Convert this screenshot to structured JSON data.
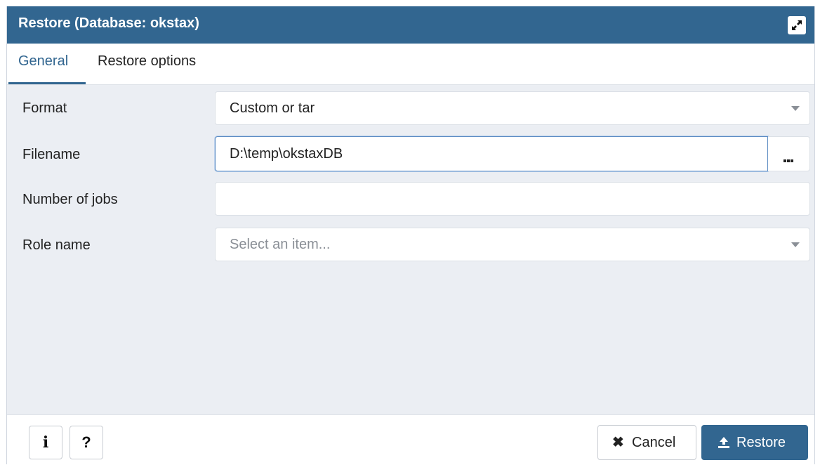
{
  "dialog": {
    "title": "Restore (Database: okstax)",
    "maximize_icon": "expand-icon"
  },
  "tabs": [
    {
      "label": "General",
      "active": true
    },
    {
      "label": "Restore options",
      "active": false
    }
  ],
  "form": {
    "format": {
      "label": "Format",
      "value": "Custom or tar"
    },
    "filename": {
      "label": "Filename",
      "value": "D:\\temp\\okstaxDB",
      "browse_icon": "ellipsis-icon"
    },
    "jobs": {
      "label": "Number of jobs",
      "value": ""
    },
    "role": {
      "label": "Role name",
      "placeholder": "Select an item..."
    }
  },
  "footer": {
    "info_glyph": "i",
    "help_glyph": "?",
    "cancel_icon": "✖",
    "cancel_label": "Cancel",
    "restore_icon": "upload-icon",
    "restore_label": "Restore"
  },
  "colors": {
    "header": "#326690",
    "background": "#ebeef3",
    "primary_button": "#326690"
  }
}
